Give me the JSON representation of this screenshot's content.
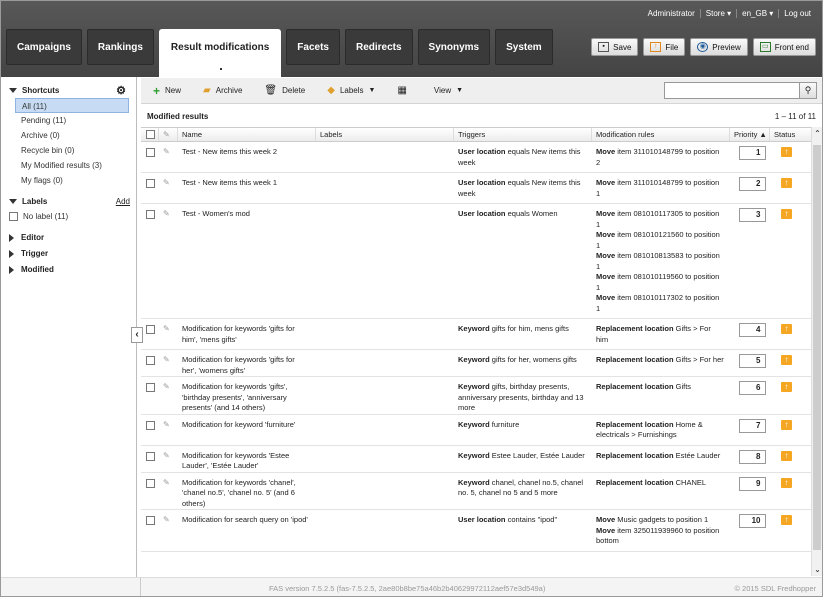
{
  "top_links": [
    "Administrator",
    "Store ▾",
    "en_GB ▾",
    "Log out"
  ],
  "tabs": [
    "Campaigns",
    "Rankings",
    "Result modifications",
    "Facets",
    "Redirects",
    "Synonyms",
    "System"
  ],
  "top_buttons": [
    {
      "label": "Save",
      "icon": "save-icon"
    },
    {
      "label": "File",
      "icon": "upload-icon"
    },
    {
      "label": "Preview",
      "icon": "preview-icon"
    },
    {
      "label": "Front end",
      "icon": "monitor-icon"
    }
  ],
  "sidebar": {
    "shortcuts_title": "Shortcuts",
    "shortcuts": [
      "All (11)",
      "Pending (11)",
      "Archive (0)",
      "Recycle bin (0)",
      "My Modified results (3)",
      "My flags (0)"
    ],
    "labels_title": "Labels",
    "labels_add": "Add",
    "no_label": "No label (11)",
    "sections": [
      "Editor",
      "Trigger",
      "Modified"
    ]
  },
  "toolbar": {
    "new": "New",
    "archive": "Archive",
    "delete": "Delete",
    "labels": "Labels",
    "view": "View"
  },
  "grid_title": "Modified results",
  "range": "1 – 11 of 11",
  "columns": [
    "Name",
    "Labels",
    "Triggers",
    "Modification rules",
    "Priority ▲",
    "Status"
  ],
  "rows": [
    {
      "name": "Test - New items this week 2",
      "trigger_bold": "User location",
      "trigger": " equals New items this week",
      "rules": [
        {
          "b": "Move",
          "t": " item 311010148799 to position 2"
        }
      ],
      "priority": "1"
    },
    {
      "name": "Test - New items this week 1",
      "trigger_bold": "User location",
      "trigger": " equals New items this week",
      "rules": [
        {
          "b": "Move",
          "t": " item 311010148799 to position 1"
        }
      ],
      "priority": "2"
    },
    {
      "name": "Test - Women's mod",
      "trigger_bold": "User location",
      "trigger": " equals Women",
      "rules": [
        {
          "b": "Move",
          "t": " item 081010117305 to position 1"
        },
        {
          "b": "Move",
          "t": " item 081010121560 to position 1"
        },
        {
          "b": "Move",
          "t": " item 081010813583 to position 1"
        },
        {
          "b": "Move",
          "t": " item 081010119560 to position 1"
        },
        {
          "b": "Move",
          "t": " item 081010117302 to position 1"
        }
      ],
      "priority": "3"
    },
    {
      "name": "Modification for keywords 'gifts for him', 'mens gifts'",
      "trigger_bold": "Keyword",
      "trigger": " gifts for him, mens gifts",
      "rules": [
        {
          "b": "Replacement location",
          "t": " Gifts > For him"
        }
      ],
      "priority": "4"
    },
    {
      "name": "Modification for keywords 'gifts for her', 'womens gifts'",
      "trigger_bold": "Keyword",
      "trigger": " gifts for her, womens gifts",
      "rules": [
        {
          "b": "Replacement location",
          "t": " Gifts > For her"
        }
      ],
      "priority": "5"
    },
    {
      "name": "Modification for keywords 'gifts', 'birthday presents', 'anniversary presents' (and 14 others)",
      "trigger_bold": "Keyword",
      "trigger": " gifts, birthday presents, anniversary presents, birthday and 13 more",
      "rules": [
        {
          "b": "Replacement location",
          "t": " Gifts"
        }
      ],
      "priority": "6"
    },
    {
      "name": "Modification for keyword 'furniture'",
      "trigger_bold": "Keyword",
      "trigger": " furniture",
      "rules": [
        {
          "b": "Replacement location",
          "t": " Home & electricals > Furnishings"
        }
      ],
      "priority": "7"
    },
    {
      "name": "Modification for keywords 'Estee Lauder', 'Estée Lauder'",
      "trigger_bold": "Keyword",
      "trigger": " Estee Lauder, Estée Lauder",
      "rules": [
        {
          "b": "Replacement location",
          "t": " Estée Lauder"
        }
      ],
      "priority": "8"
    },
    {
      "name": "Modification for keywords 'chanel', 'chanel no.5', 'chanel no. 5' (and 6 others)",
      "trigger_bold": "Keyword",
      "trigger": " chanel, chanel no.5, chanel no. 5, chanel no 5 and 5 more",
      "rules": [
        {
          "b": "Replacement location",
          "t": " CHANEL"
        }
      ],
      "priority": "9"
    },
    {
      "name": "Modification for search query on 'ipod'",
      "trigger_bold": "User location",
      "trigger": " contains \"ipod\"",
      "rules": [
        {
          "b": "Move",
          "t": " Music gadgets  to position 1"
        },
        {
          "b": "Move",
          "t": " item 325011939960 to position bottom"
        }
      ],
      "priority": "10"
    }
  ],
  "footer": {
    "version": "FAS version 7.5.2.5 (fas-7.5.2.5, 2ae80b8be75a46b2b40629972112aef57e3d549a)",
    "copyright": "© 2015 SDL Fredhopper"
  }
}
